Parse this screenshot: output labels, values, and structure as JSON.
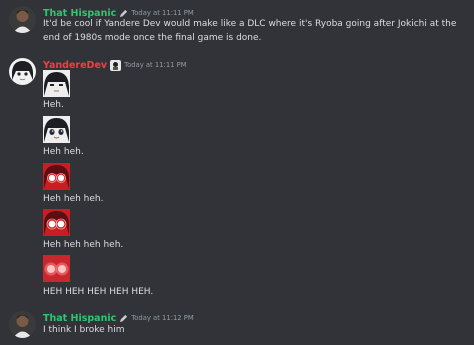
{
  "messages": [
    {
      "username": "That Hispanic",
      "username_color": "#2dc770",
      "timestamp": "Today at 11:11 PM",
      "text": "It'd be cool if Yandere Dev would make like a DLC where it's Ryoba going after Jokichi at the end of 1980s mode once the final game is done."
    },
    {
      "username": "YandereDev",
      "username_color": "#f23f43",
      "timestamp": "Today at 11:11 PM",
      "lines": [
        "Heh.",
        "Heh heh.",
        "Heh heh heh.",
        "Heh heh heh heh.",
        "HEH HEH HEH HEH HEH."
      ]
    },
    {
      "username": "That Hispanic",
      "username_color": "#2dc770",
      "timestamp": "Today at 11:12 PM",
      "text": "I think I broke him"
    }
  ],
  "icons": {
    "edit_badge": "pencil-icon"
  }
}
